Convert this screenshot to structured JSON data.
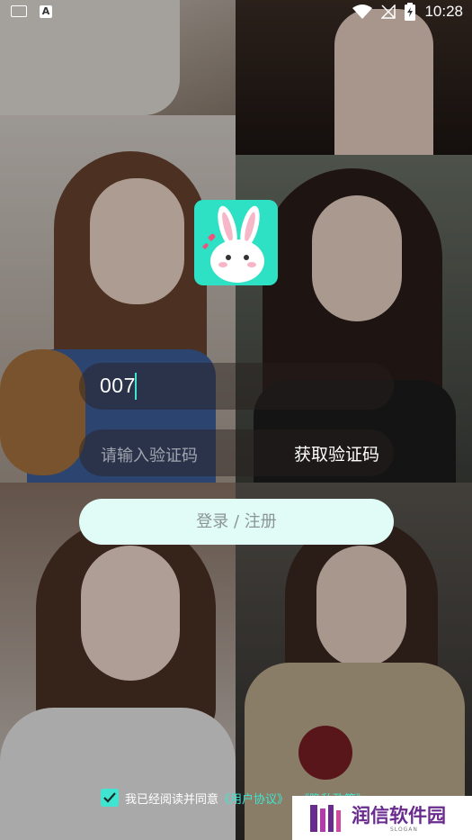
{
  "status_bar": {
    "time": "10:28"
  },
  "phone_input": {
    "value": "007"
  },
  "code_input": {
    "placeholder": "请输入验证码"
  },
  "get_code_label": "获取验证码",
  "login_label": "登录 / 注册",
  "agreement": {
    "checked": true,
    "prefix": "我已经阅读并同意",
    "user_agreement": "《用户协议》",
    "privacy_fragment": "《隐私政策》"
  },
  "watermark": {
    "text": "润信软件园",
    "slogan": "SLOGAN"
  },
  "colors": {
    "accent": "#3fe5d0",
    "login_bg": "#e1fbf6",
    "icon_bg": "#2ee0c4"
  }
}
